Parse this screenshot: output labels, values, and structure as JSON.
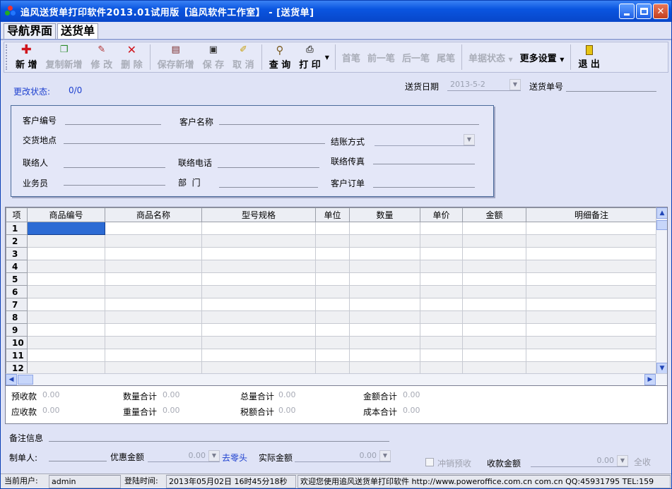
{
  "window": {
    "title": "追风送货单打印软件2013.01试用版【追风软件工作室】 - [送货单]",
    "controls": [
      "minimize",
      "maximize",
      "close"
    ]
  },
  "tabs": [
    {
      "label": "导航界面",
      "active": false
    },
    {
      "label": "送货单",
      "active": true
    }
  ],
  "toolbar": {
    "new": "新 增",
    "copy_new": "复制新增",
    "edit": "修 改",
    "delete": "删 除",
    "save_new": "保存新增",
    "save": "保 存",
    "cancel": "取 消",
    "query": "查 询",
    "print": "打 印",
    "first": "首笔",
    "prev": "前一笔",
    "next": "后一笔",
    "last": "尾笔",
    "doc_status": "单据状态",
    "more_settings": "更多设置",
    "exit": "退 出"
  },
  "header": {
    "change_status_label": "更改状态:",
    "change_status_value": "0/0",
    "delivery_date_label": "送货日期",
    "delivery_date_value": "2013-5-2",
    "delivery_no_label": "送货单号"
  },
  "customer": {
    "code_label": "客户编号",
    "name_label": "客户名称",
    "address_label": "交货地点",
    "settlement_label": "结账方式",
    "contact_label": "联络人",
    "phone_label": "联络电话",
    "fax_label": "联络传真",
    "salesman_label": "业务员",
    "dept_label": "部  门",
    "order_label": "客户订单"
  },
  "grid": {
    "columns": [
      "项",
      "商品编号",
      "商品名称",
      "型号规格",
      "单位",
      "数量",
      "单价",
      "金额",
      "明细备注"
    ],
    "rows": [
      "1",
      "2",
      "3",
      "4",
      "5",
      "6",
      "7",
      "8",
      "9",
      "10",
      "11",
      "12"
    ]
  },
  "totals": {
    "prepaid_label": "预收款",
    "prepaid": "0.00",
    "qty_total_label": "数量合计",
    "qty_total": "0.00",
    "total_qty_label": "总量合计",
    "total_qty": "0.00",
    "amount_total_label": "金额合计",
    "amount_total": "0.00",
    "receivable_label": "应收款",
    "receivable": "0.00",
    "weight_total_label": "重量合计",
    "weight_total": "0.00",
    "tax_total_label": "税额合计",
    "tax_total": "0.00",
    "cost_total_label": "成本合计",
    "cost_total": "0.00"
  },
  "footer": {
    "remark_label": "备注信息",
    "maker_label": "制单人:",
    "discount_label": "优惠金额",
    "discount_value": "0.00",
    "round_off_link": "去零头",
    "actual_label": "实际金额",
    "actual_value": "0.00",
    "writeoff_label": "冲销预收",
    "received_label": "收款金额",
    "received_value": "0.00",
    "full_receive": "全收"
  },
  "statusbar": {
    "user_label": "当前用户:",
    "user": "admin",
    "login_label": "登陆时间:",
    "login_time": "2013年05月02日 16时45分18秒",
    "welcome": "欢迎您使用追风送货单打印软件 http://www.poweroffice.com.cn com.cn QQ:45931795 TEL:159"
  },
  "colors": {
    "titlebar": "#0a55e0",
    "window_bg": "#dfe3f6",
    "selection": "#2c6bd4",
    "link_blue": "#1c3fcf"
  }
}
